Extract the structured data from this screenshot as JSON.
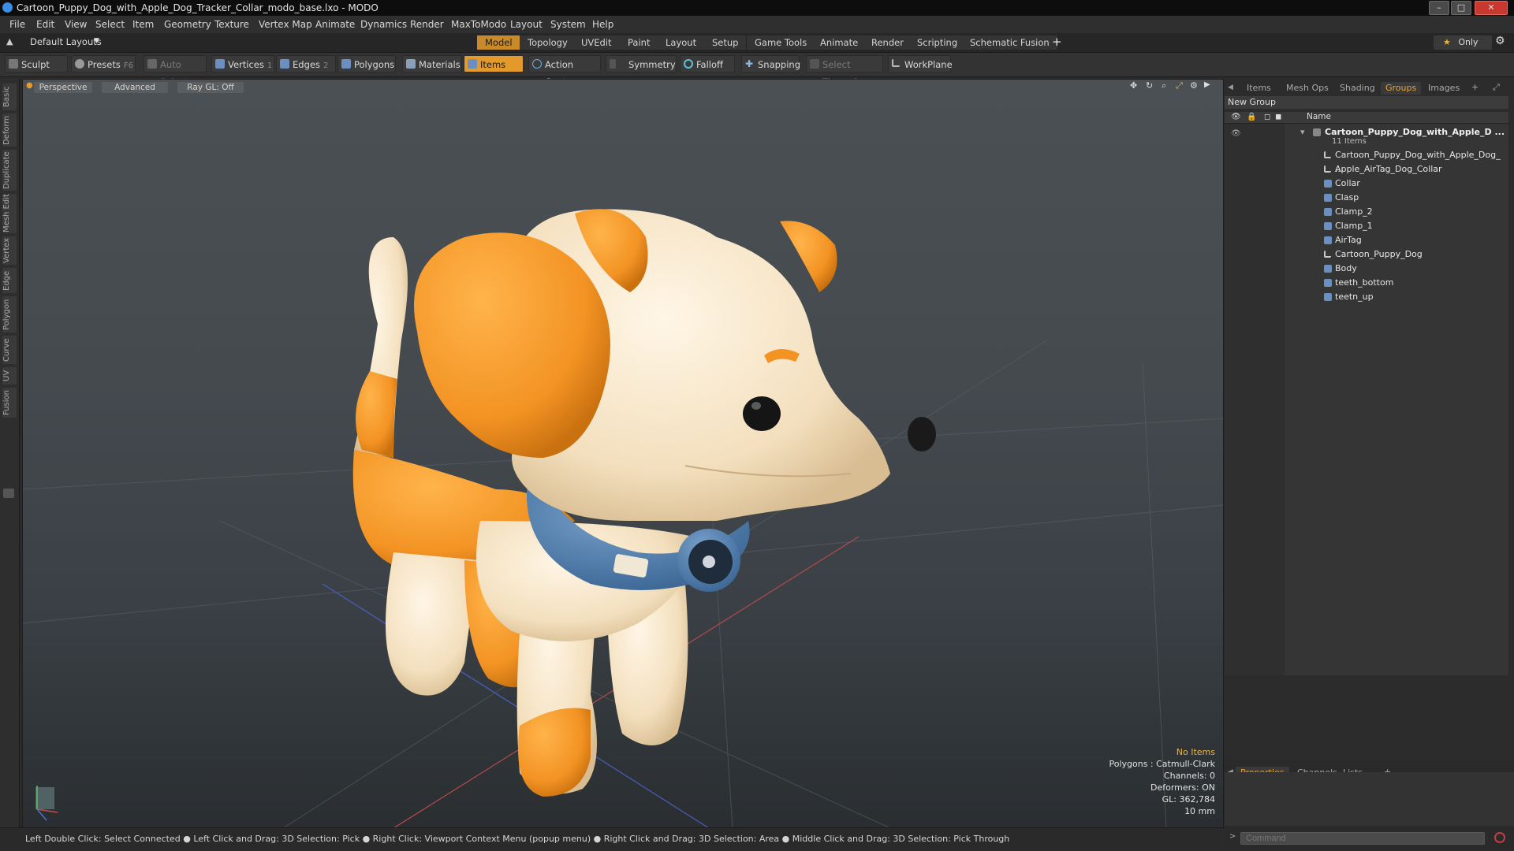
{
  "window": {
    "title": "Cartoon_Puppy_Dog_with_Apple_Dog_Tracker_Collar_modo_base.lxo - MODO",
    "minimize": "–",
    "maximize": "□",
    "close": "✕"
  },
  "menu": [
    "File",
    "Edit",
    "View",
    "Select",
    "Item",
    "Geometry",
    "Texture",
    "Vertex Map",
    "Animate",
    "Dynamics",
    "Render",
    "MaxToModo",
    "Layout",
    "System",
    "Help"
  ],
  "layoutbar": {
    "layouts_label": "Default Layouts",
    "tabs": [
      "Model",
      "Topology",
      "UVEdit",
      "Paint",
      "Layout",
      "Setup",
      "Game Tools",
      "Animate",
      "Render",
      "Scripting",
      "Schematic Fusion"
    ],
    "active_tab": "Model",
    "add": "+",
    "only": "Only"
  },
  "toolbar": {
    "sculpt": "Sculpt",
    "presets": "Presets",
    "presets_key": "F6",
    "auto_select": "Auto Select",
    "vertices": "Vertices",
    "vertices_key": "1",
    "edges": "Edges",
    "edges_key": "2",
    "polygons": "Polygons",
    "materials": "Materials",
    "items": "Items",
    "action_center": "Action Center",
    "symmetry": "Symmetry",
    "falloff": "Falloff",
    "snapping": "Snapping",
    "select_through": "Select Through",
    "workplane": "WorkPlane"
  },
  "lefttabs": [
    "Basic",
    "Deform",
    "Duplicate",
    "Mesh Edit",
    "Vertex",
    "Edge",
    "Polygon",
    "Curve",
    "UV",
    "Fusion"
  ],
  "viewport": {
    "view": "Perspective",
    "shading": "Advanced",
    "raygl": "Ray GL: Off",
    "info": {
      "no_items": "No Items",
      "polygons": "Polygons : Catmull-Clark",
      "channels": "Channels: 0",
      "deformers": "Deformers: ON",
      "gl": "GL: 362,784",
      "scale": "10 mm"
    }
  },
  "rightpanel": {
    "tabs": [
      "Items",
      "Mesh Ops",
      "Shading",
      "Groups",
      "Images"
    ],
    "active_tab": "Groups",
    "add": "+",
    "new_group": "New Group",
    "col_name": "Name",
    "group_name": "Cartoon_Puppy_Dog_with_Apple_D ...",
    "group_count": "11 Items",
    "items": [
      {
        "name": "Cartoon_Puppy_Dog_with_Apple_Dog_ ...",
        "type": "locator"
      },
      {
        "name": "Apple_AirTag_Dog_Collar",
        "type": "locator"
      },
      {
        "name": "Collar",
        "type": "mesh"
      },
      {
        "name": "Clasp",
        "type": "mesh"
      },
      {
        "name": "Clamp_2",
        "type": "mesh"
      },
      {
        "name": "Clamp_1",
        "type": "mesh"
      },
      {
        "name": "AirTag",
        "type": "mesh"
      },
      {
        "name": "Cartoon_Puppy_Dog",
        "type": "locator"
      },
      {
        "name": "Body",
        "type": "mesh"
      },
      {
        "name": "teeth_bottom",
        "type": "mesh"
      },
      {
        "name": "teetn_up",
        "type": "mesh"
      }
    ],
    "bottom_tabs": [
      "Properties",
      "Channels",
      "Lists"
    ],
    "bottom_active": "Properties"
  },
  "statusbar": "Left Double Click: Select Connected ● Left Click and Drag: 3D Selection: Pick ● Right Click: Viewport Context Menu (popup menu) ● Right Click and Drag: 3D Selection: Area ● Middle Click and Drag: 3D Selection: Pick Through",
  "command": {
    "placeholder": "Command"
  },
  "colors": {
    "accent": "#e39a2a",
    "dog_orange": "#f59a2b",
    "dog_cream": "#f6e6c8",
    "collar_blue": "#4f7fb0"
  }
}
